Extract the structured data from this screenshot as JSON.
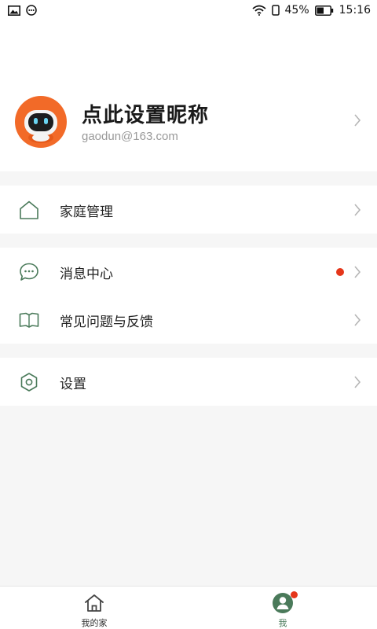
{
  "status_bar": {
    "battery": "45%",
    "time": "15:16"
  },
  "profile": {
    "nickname": "点此设置昵称",
    "email": "gaodun@163.com"
  },
  "menu": {
    "family_management": "家庭管理",
    "message_center": "消息中心",
    "faq_feedback": "常见问题与反馈",
    "settings": "设置"
  },
  "tabs": {
    "my_home": "我的家",
    "me": "我"
  },
  "colors": {
    "accent": "#4a7a5a",
    "badge": "#e5361a",
    "avatar_orange": "#f26a28"
  }
}
